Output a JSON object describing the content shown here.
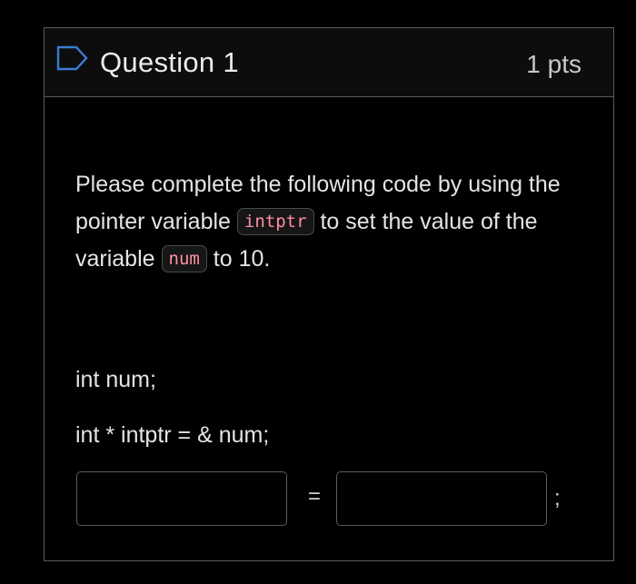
{
  "question": {
    "title": "Question 1",
    "points": "1 pts",
    "flag_icon": "flag-outline-icon"
  },
  "prompt": {
    "text_part1": "Please complete the following code by using the pointer variable",
    "code1": "intptr",
    "text_part2": "to set the value of the variable",
    "code2": "num",
    "text_part3": "to 10."
  },
  "code_lines": {
    "line1": "int num;",
    "line2": "int * intptr = & num;"
  },
  "answer": {
    "left_value": "",
    "right_value": "",
    "equals": "=",
    "semicolon": ";"
  },
  "colors": {
    "background": "#000000",
    "border": "#5a5a5a",
    "code_text": "#ff8fa3",
    "flag_accent": "#3b7bd1"
  }
}
